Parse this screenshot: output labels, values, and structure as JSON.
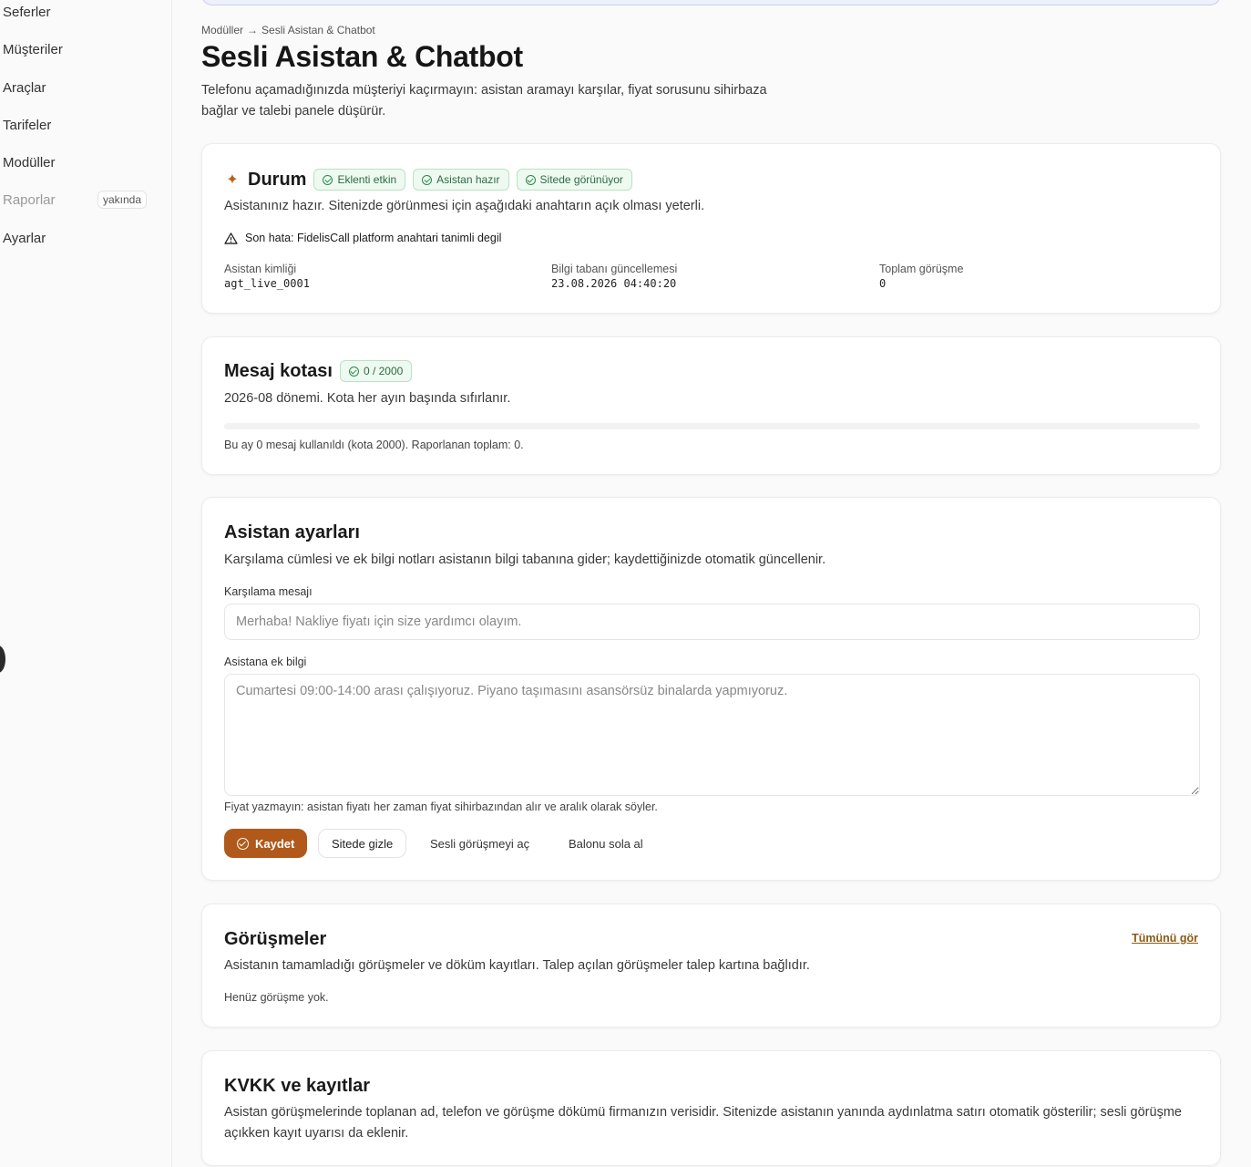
{
  "sidebar": {
    "items": [
      {
        "label": "Seferler"
      },
      {
        "label": "Müşteriler"
      },
      {
        "label": "Araçlar"
      },
      {
        "label": "Tarifeler"
      },
      {
        "label": "Modüller"
      },
      {
        "label": "Raporlar",
        "badge": "yakında"
      },
      {
        "label": "Ayarlar"
      }
    ]
  },
  "breadcrumb": {
    "parent": "Modüller",
    "separator": "→",
    "current": "Sesli Asistan & Chatbot"
  },
  "page": {
    "title": "Sesli Asistan & Chatbot",
    "description": "Telefonu açamadığınızda müşteriyi kaçırmayın: asistan aramayı karşılar, fiyat sorusunu sihirbaza bağlar ve talebi panele düşürür."
  },
  "status_card": {
    "title": "Durum",
    "badges": [
      "Eklenti etkin",
      "Asistan hazır",
      "Sitede görünüyor"
    ],
    "description": "Asistanınız hazır. Sitenizde görünmesi için aşağıdaki anahtarın açık olması yeterli.",
    "error": "Son hata: FidelisCall platform anahtari tanimli degil",
    "meta": [
      {
        "label": "Asistan kimliği",
        "value": "agt_live_0001"
      },
      {
        "label": "Bilgi tabanı güncellemesi",
        "value": "23.08.2026 04:40:20"
      },
      {
        "label": "Toplam görüşme",
        "value": "0"
      }
    ]
  },
  "quota_card": {
    "title": "Mesaj kotası",
    "badge": "0 / 2000",
    "used": 0,
    "limit": 2000,
    "description": "2026-08 dönemi. Kota her ayın başında sıfırlanır.",
    "note": "Bu ay 0 mesaj kullanıldı (kota 2000). Raporlanan toplam: 0."
  },
  "settings_card": {
    "title": "Asistan ayarları",
    "description": "Karşılama cümlesi ve ek bilgi notları asistanın bilgi tabanına gider; kaydettiğinizde otomatik güncellenir.",
    "greeting_label": "Karşılama mesajı",
    "greeting_placeholder": "Merhaba! Nakliye fiyatı için size yardımcı olayım.",
    "extra_label": "Asistana ek bilgi",
    "extra_placeholder": "Cumartesi 09:00-14:00 arası çalışıyoruz. Piyano taşımasını asansörsüz binalarda yapmıyoruz.",
    "hint": "Fiyat yazmayın: asistan fiyatı her zaman fiyat sihirbazından alır ve aralık olarak söyler.",
    "buttons": {
      "save": "Kaydet",
      "hide": "Sitede gizle",
      "voice": "Sesli görüşmeyi aç",
      "balloon": "Balonu sola al"
    }
  },
  "conversations_card": {
    "title": "Görüşmeler",
    "link": "Tümünü gör",
    "description": "Asistanın tamamladığı görüşmeler ve döküm kayıtları. Talep açılan görüşmeler talep kartına bağlıdır.",
    "empty": "Henüz görüşme yok."
  },
  "kvkk_card": {
    "title": "KVKK ve kayıtlar",
    "description": "Asistan görüşmelerinde toplanan ad, telefon ve görüşme dökümü firmanızın verisidir. Sitenizde asistanın yanında aydınlatma satırı otomatik gösterilir; sesli görüşme açıkken kayıt uyarısı da eklenir."
  },
  "colors": {
    "accent": "#b0591a",
    "success": "#2b8a4a"
  }
}
